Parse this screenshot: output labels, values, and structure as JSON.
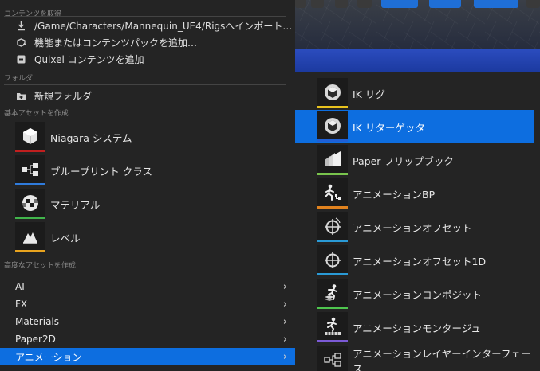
{
  "left_menu": {
    "section_get_content": "コンテンツを取得",
    "get_content_items": [
      {
        "label": "/Game/Characters/Mannequin_UE4/Rigsへインポート…",
        "icon": "import-icon"
      },
      {
        "label": "機能またはコンテンツパックを追加…",
        "icon": "add-pack-icon"
      },
      {
        "label": "Quixel コンテンツを追加",
        "icon": "quixel-icon"
      }
    ],
    "section_folder": "フォルダ",
    "folder_items": [
      {
        "label": "新規フォルダ",
        "icon": "new-folder-icon"
      }
    ],
    "section_basic_assets": "基本アセットを作成",
    "basic_assets": [
      {
        "label": "Niagara システム",
        "icon": "niagara-icon",
        "color": "#c01f1f"
      },
      {
        "label": "ブループリント クラス",
        "icon": "blueprint-icon",
        "color": "#2f7bdc"
      },
      {
        "label": "マテリアル",
        "icon": "material-icon",
        "color": "#41b54b"
      },
      {
        "label": "レベル",
        "icon": "level-icon",
        "color": "#e8a31e"
      }
    ],
    "section_advanced": "高度なアセットを作成",
    "advanced_items": [
      {
        "label": "AI",
        "selected": false
      },
      {
        "label": "FX",
        "selected": false
      },
      {
        "label": "Materials",
        "selected": false
      },
      {
        "label": "Paper2D",
        "selected": false
      },
      {
        "label": "アニメーション",
        "selected": true
      }
    ]
  },
  "right_menu": {
    "items": [
      {
        "label": "IK リグ",
        "icon": "ik-rig-icon",
        "color": "#e8c21e",
        "selected": false
      },
      {
        "label": "IK リターゲッタ",
        "icon": "ik-retargeter-icon",
        "color": "#1f5fd6",
        "selected": true
      },
      {
        "label": "Paper フリップブック",
        "icon": "paper-flipbook-icon",
        "color": "#79c44d",
        "selected": false
      },
      {
        "label": "アニメーションBP",
        "icon": "animation-bp-icon",
        "color": "#e0821e",
        "selected": false
      },
      {
        "label": "アニメーションオフセット",
        "icon": "aim-offset-icon",
        "color": "#2a9ad6",
        "selected": false
      },
      {
        "label": "アニメーションオフセット1D",
        "icon": "aim-offset-1d-icon",
        "color": "#2a9ad6",
        "selected": false
      },
      {
        "label": "アニメーションコンポジット",
        "icon": "anim-composite-icon",
        "color": "#4ec54e",
        "selected": false
      },
      {
        "label": "アニメーションモンタージュ",
        "icon": "anim-montage-icon",
        "color": "#7b5ad6",
        "selected": false
      },
      {
        "label": "アニメーションレイヤーインターフェース",
        "icon": "anim-layer-interface-icon",
        "color": "#e0821e",
        "selected": false
      }
    ]
  },
  "colors": {
    "accent": "#0d6ee0",
    "menu_bg": "#242424",
    "thumb_bg": "#1b1b1b"
  }
}
